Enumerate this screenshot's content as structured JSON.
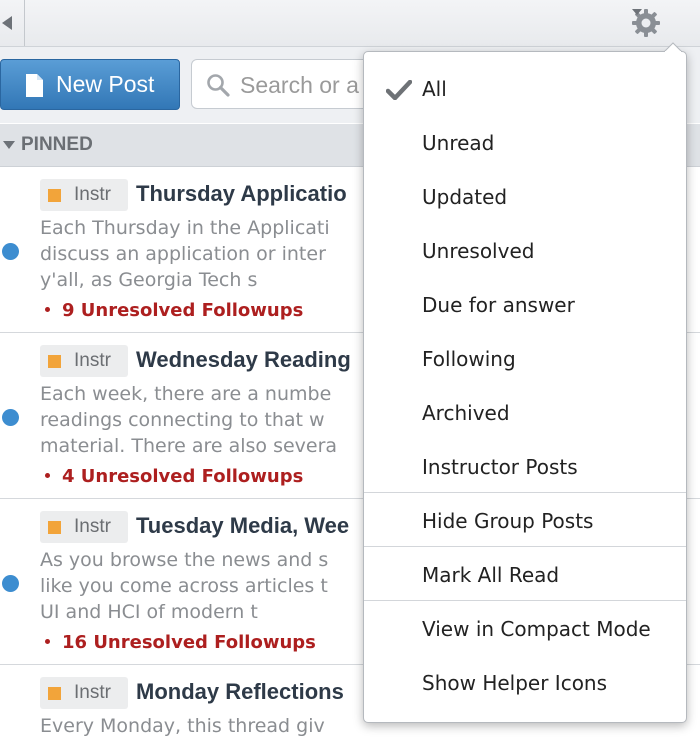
{
  "search": {
    "placeholder": "Search or a"
  },
  "toolbar": {
    "new_post_label": "New Post"
  },
  "pinned": {
    "label": "PINNED"
  },
  "feed": [
    {
      "tag": "Instr",
      "title": "Thursday Applicatio",
      "snippet": [
        "Each Thursday in the Applicati",
        "discuss an application or inter",
        "y'all, as Georgia Tech s"
      ],
      "followups": "9 Unresolved Followups",
      "unread": true
    },
    {
      "tag": "Instr",
      "title": "Wednesday Reading",
      "snippet": [
        "Each week, there are a numbe",
        "readings connecting to that w",
        "material. There are also severa"
      ],
      "followups": "4 Unresolved Followups",
      "unread": true
    },
    {
      "tag": "Instr",
      "title": "Tuesday Media, Wee",
      "snippet": [
        "As you browse the news and s",
        "like you come across articles t",
        "UI and HCI of modern t"
      ],
      "followups": "16 Unresolved Followups",
      "unread": true
    },
    {
      "tag": "Instr",
      "title": "Monday Reflections",
      "snippet": [
        "Every Monday, this thread giv"
      ],
      "followups": "",
      "unread": false
    }
  ],
  "filter_menu": {
    "selected": "All",
    "items": [
      "All",
      "Unread",
      "Updated",
      "Unresolved",
      "Due for answer",
      "Following",
      "Archived",
      "Instructor Posts"
    ],
    "group_item": "Hide Group Posts",
    "mark_read_item": "Mark All Read",
    "view_items": [
      "View in Compact Mode",
      "Show Helper Icons"
    ]
  },
  "colors": {
    "accent": "#3277b6",
    "unread_dot": "#3d8dd0",
    "followups": "#ad1f1f",
    "instructor_tag": "#f2a43a"
  },
  "icons": [
    "collapse-arrow-icon",
    "gear-icon",
    "chevron-down-icon",
    "document-icon",
    "search-icon",
    "triangle-down-icon",
    "checkmark-icon"
  ]
}
